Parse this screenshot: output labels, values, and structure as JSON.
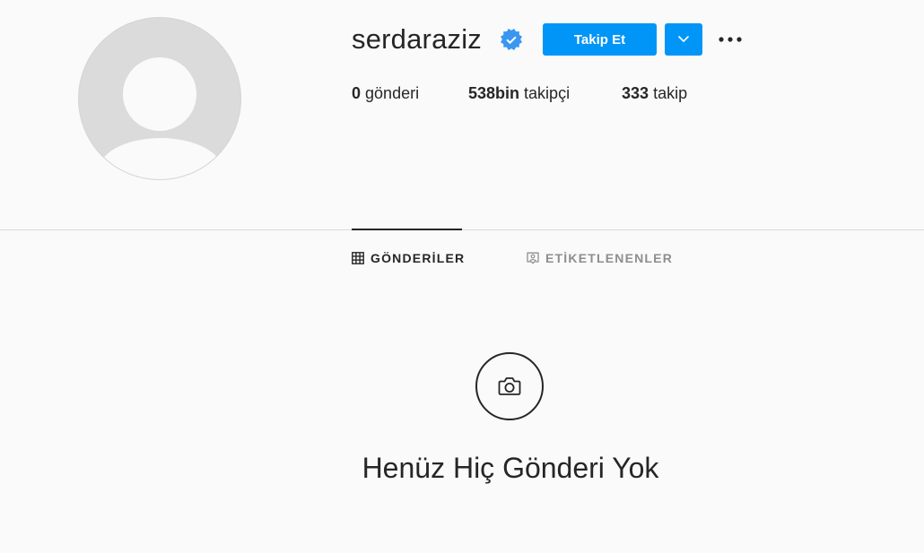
{
  "profile": {
    "username": "serdaraziz",
    "verified": true,
    "follow_label": "Takip Et",
    "accent_color": "#0095f6"
  },
  "stats": {
    "posts_count": "0",
    "posts_label": "gönderi",
    "followers_count": "538bin",
    "followers_label": "takipçi",
    "following_count": "333",
    "following_label": "takip"
  },
  "tabs": [
    {
      "label": "GÖNDERİLER",
      "icon": "grid-icon",
      "active": true
    },
    {
      "label": "ETİKETLENENLER",
      "icon": "tagged-icon",
      "active": false
    }
  ],
  "empty_state": {
    "icon": "camera-icon",
    "title": "Henüz Hiç Gönderi Yok"
  }
}
